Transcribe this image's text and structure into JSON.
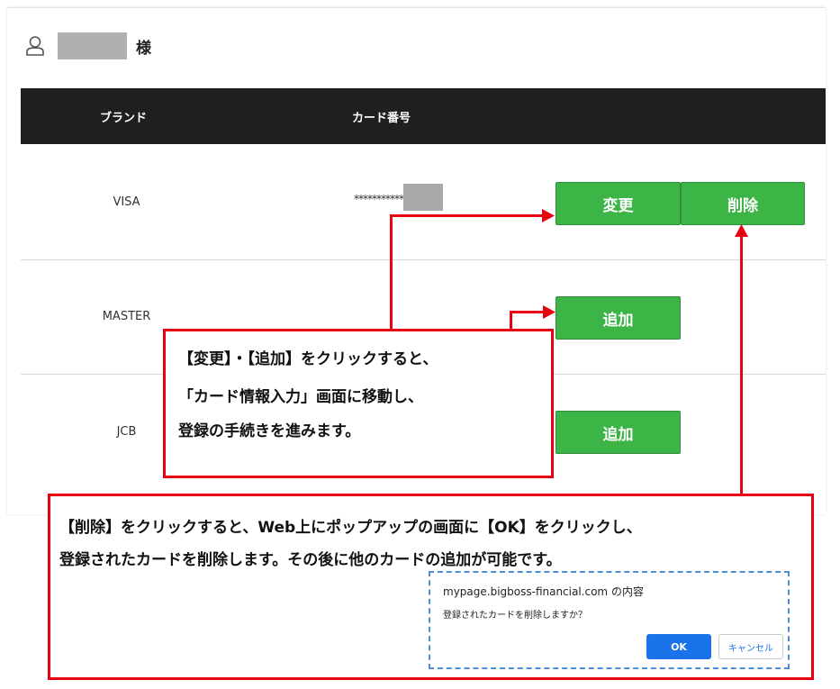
{
  "user": {
    "honorific": "様"
  },
  "table": {
    "headers": {
      "brand": "ブランド",
      "card_number": "カード番号"
    },
    "rows": [
      {
        "brand": "VISA",
        "card_number": "*************"
      },
      {
        "brand": "MASTER",
        "card_number": ""
      },
      {
        "brand": "JCB",
        "card_number": ""
      }
    ]
  },
  "buttons": {
    "change": "変更",
    "delete": "削除",
    "add": "追加"
  },
  "callout_top": {
    "lines": [
      "【変更】・【追加】をクリックすると、",
      "「カード情報入力」画面に移動し、",
      "登録の手続きを進みます。"
    ]
  },
  "callout_bottom": {
    "lines": [
      "【削除】をクリックすると、Web上にポップアップの画面に【OK】をクリックし、",
      "登録されたカードを削除します。その後に他のカードの追加が可能です。"
    ]
  },
  "dialog": {
    "title": "mypage.bigboss-financial.com の内容",
    "message": "登録されたカードを削除しますか？",
    "ok": "OK",
    "cancel": "キャンセル"
  },
  "colors": {
    "accent_green": "#3cb446",
    "callout_red": "#e60012",
    "header_dark": "#1f1f1f",
    "dialog_blue": "#1a73e8"
  }
}
